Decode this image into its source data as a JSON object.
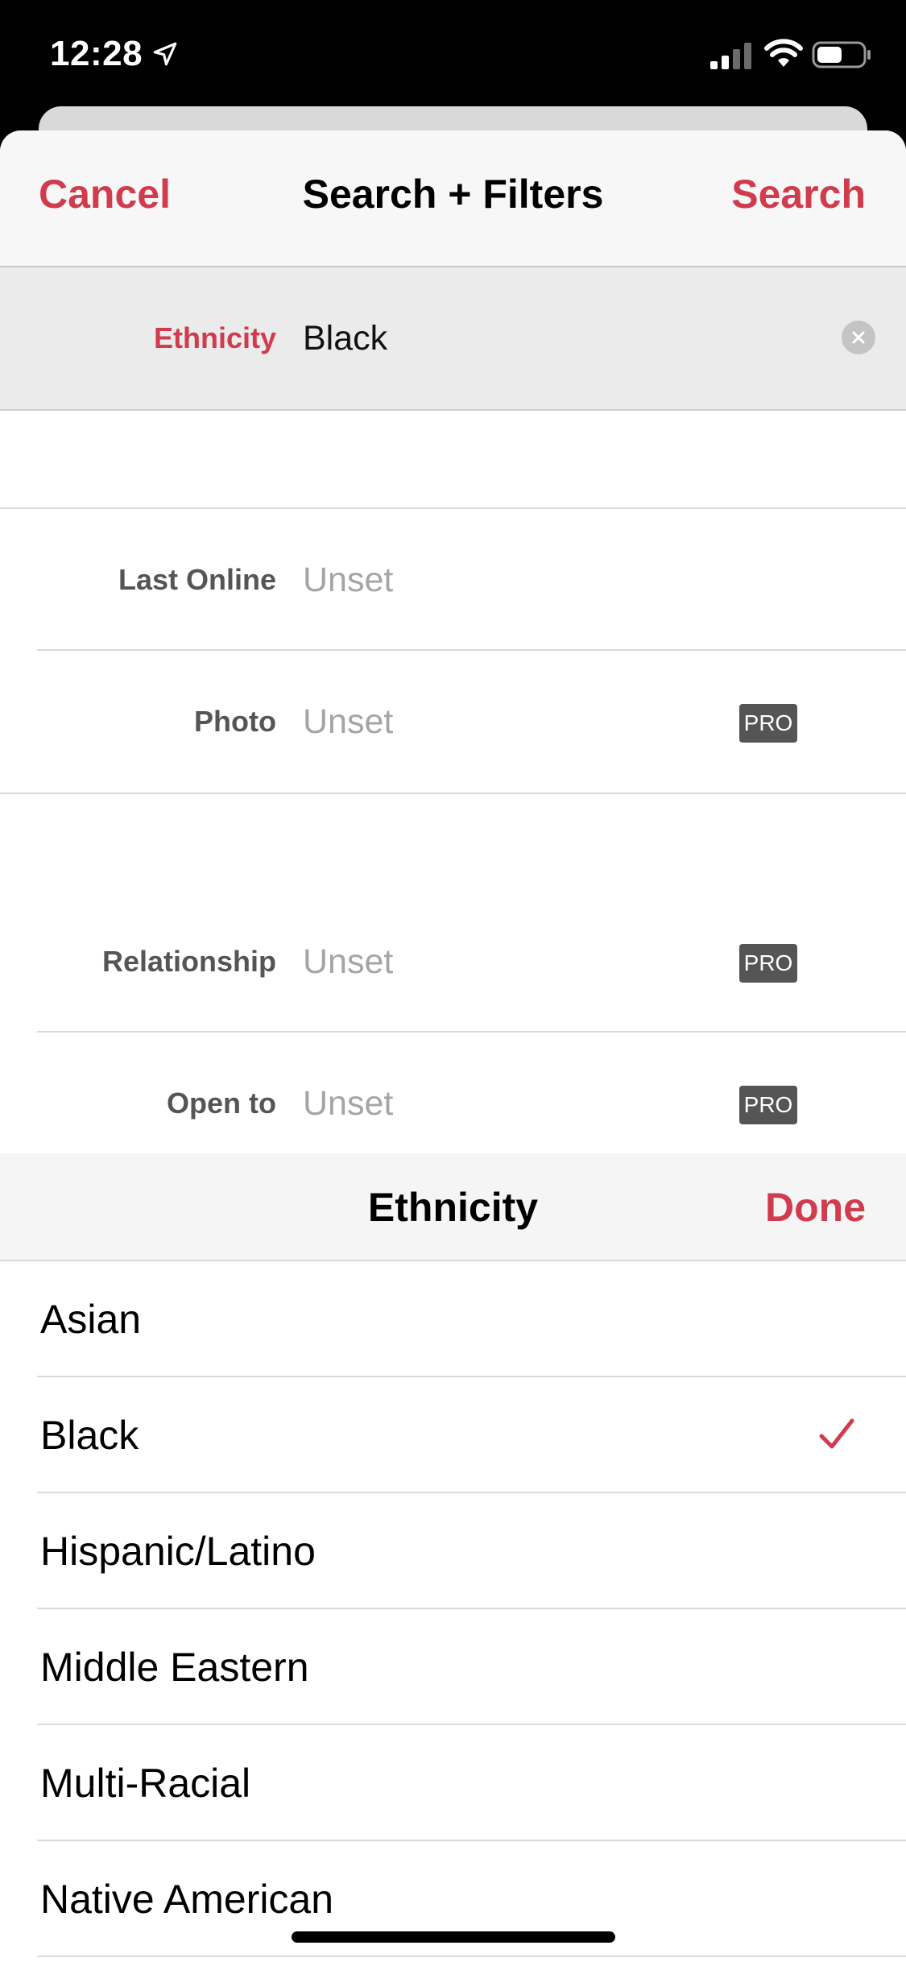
{
  "status_bar": {
    "time": "12:28",
    "icons": [
      "location-arrow-icon",
      "cellular-signal-icon",
      "wifi-icon",
      "battery-icon"
    ]
  },
  "nav": {
    "cancel_label": "Cancel",
    "title": "Search + Filters",
    "search_label": "Search"
  },
  "filters": {
    "ethnicity": {
      "label": "Ethnicity",
      "value": "Black"
    },
    "last_online": {
      "label": "Last Online",
      "value": "Unset"
    },
    "photo": {
      "label": "Photo",
      "value": "Unset",
      "badge": "PRO"
    },
    "relationship": {
      "label": "Relationship",
      "value": "Unset",
      "badge": "PRO"
    },
    "open_to": {
      "label": "Open to",
      "value": "Unset",
      "badge": "PRO"
    }
  },
  "picker": {
    "title": "Ethnicity",
    "done_label": "Done",
    "selected": "Black",
    "options": [
      "Asian",
      "Black",
      "Hispanic/Latino",
      "Middle Eastern",
      "Multi-Racial",
      "Native American"
    ]
  },
  "colors": {
    "accent": "#d03b4d",
    "label_gray": "#555555",
    "unset_gray": "#a5a5a5",
    "pro_badge": "#555555"
  }
}
